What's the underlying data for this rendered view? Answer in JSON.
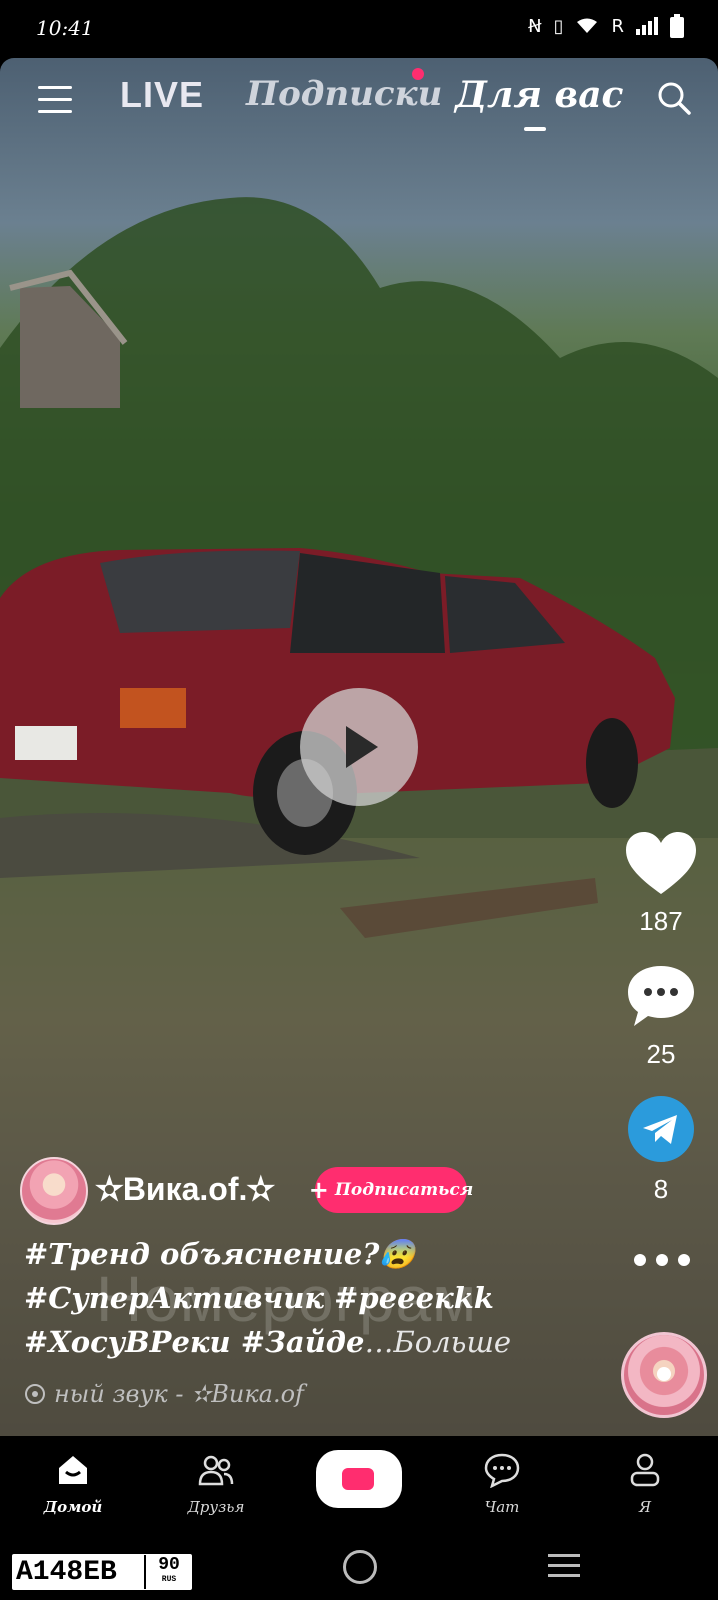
{
  "status_bar": {
    "time": "10:41",
    "network_letter": "R"
  },
  "top_tabs": {
    "live": "LIVE",
    "subscriptions": "Подписки",
    "for_you": "Для вас"
  },
  "engagement": {
    "likes": "187",
    "comments": "25",
    "shares": "8"
  },
  "author": {
    "username": "✫Вика.of.✫",
    "follow_label": "Подписаться"
  },
  "caption": {
    "line1": "#Тренд объяснение?😰",
    "line2": "#СуперАктивчик #рееекkk",
    "line3": "#ХосуВРеки #Зайде",
    "more": "…Больше"
  },
  "sound": {
    "text": "ный звук - ✫Вика.of"
  },
  "watermark": "Номерограм",
  "bottom_nav": {
    "home": "Домой",
    "friends": "Друзья",
    "chat": "Чат",
    "me": "Я"
  },
  "plate": {
    "number": "А148ЕВ",
    "region": "90",
    "country": "RUS"
  },
  "colors": {
    "accent": "#ff2d6f",
    "share": "#2b9bdc"
  }
}
